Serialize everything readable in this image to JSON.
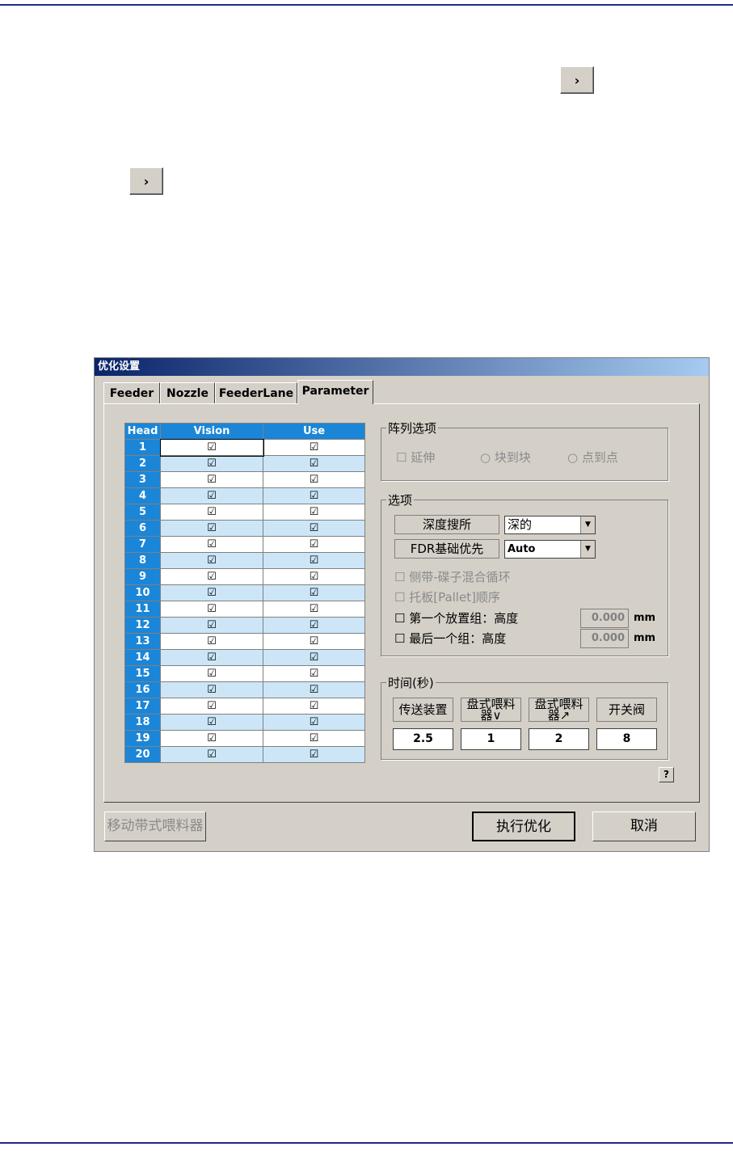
{
  "nav": {
    "next_glyph": "›"
  },
  "dialog": {
    "title": "优化设置",
    "tabs": [
      "Feeder",
      "Nozzle",
      "FeederLane",
      "Parameter"
    ],
    "table": {
      "headers": [
        "Head",
        "Vision",
        "Use"
      ],
      "check_glyph": "☑",
      "rows": [
        "1",
        "2",
        "3",
        "4",
        "5",
        "6",
        "7",
        "8",
        "9",
        "10",
        "11",
        "12",
        "13",
        "14",
        "15",
        "16",
        "17",
        "18",
        "19",
        "20"
      ]
    },
    "array_options": {
      "title": "阵列选项",
      "extend": "延伸",
      "block_to_block": "块到块",
      "point_to_point": "点到点"
    },
    "options": {
      "title": "选项",
      "depth_search_label": "深度搜所",
      "depth_search_value": "深的",
      "fdr_priority_label": "FDR基础优先",
      "fdr_priority_value": "Auto",
      "side_tray_mix": "侧带-碟子混合循环",
      "pallet_order": "托板[Pallet]顺序",
      "first_group_height": "第一个放置组：高度",
      "last_group_height": "最后一个组：高度",
      "first_height_value": "0.000",
      "last_height_value": "0.000",
      "unit": "mm"
    },
    "time": {
      "title": "时间(秒)",
      "labels": [
        "传送装置",
        "盘式喂料器∨",
        "盘式喂料器↗",
        "开关阀"
      ],
      "values": [
        "2.5",
        "1",
        "2",
        "8"
      ]
    },
    "help_label": "?",
    "move_feeder_button": "移动带式喂料器",
    "optimize_button": "执行优化",
    "cancel_button": "取消"
  }
}
